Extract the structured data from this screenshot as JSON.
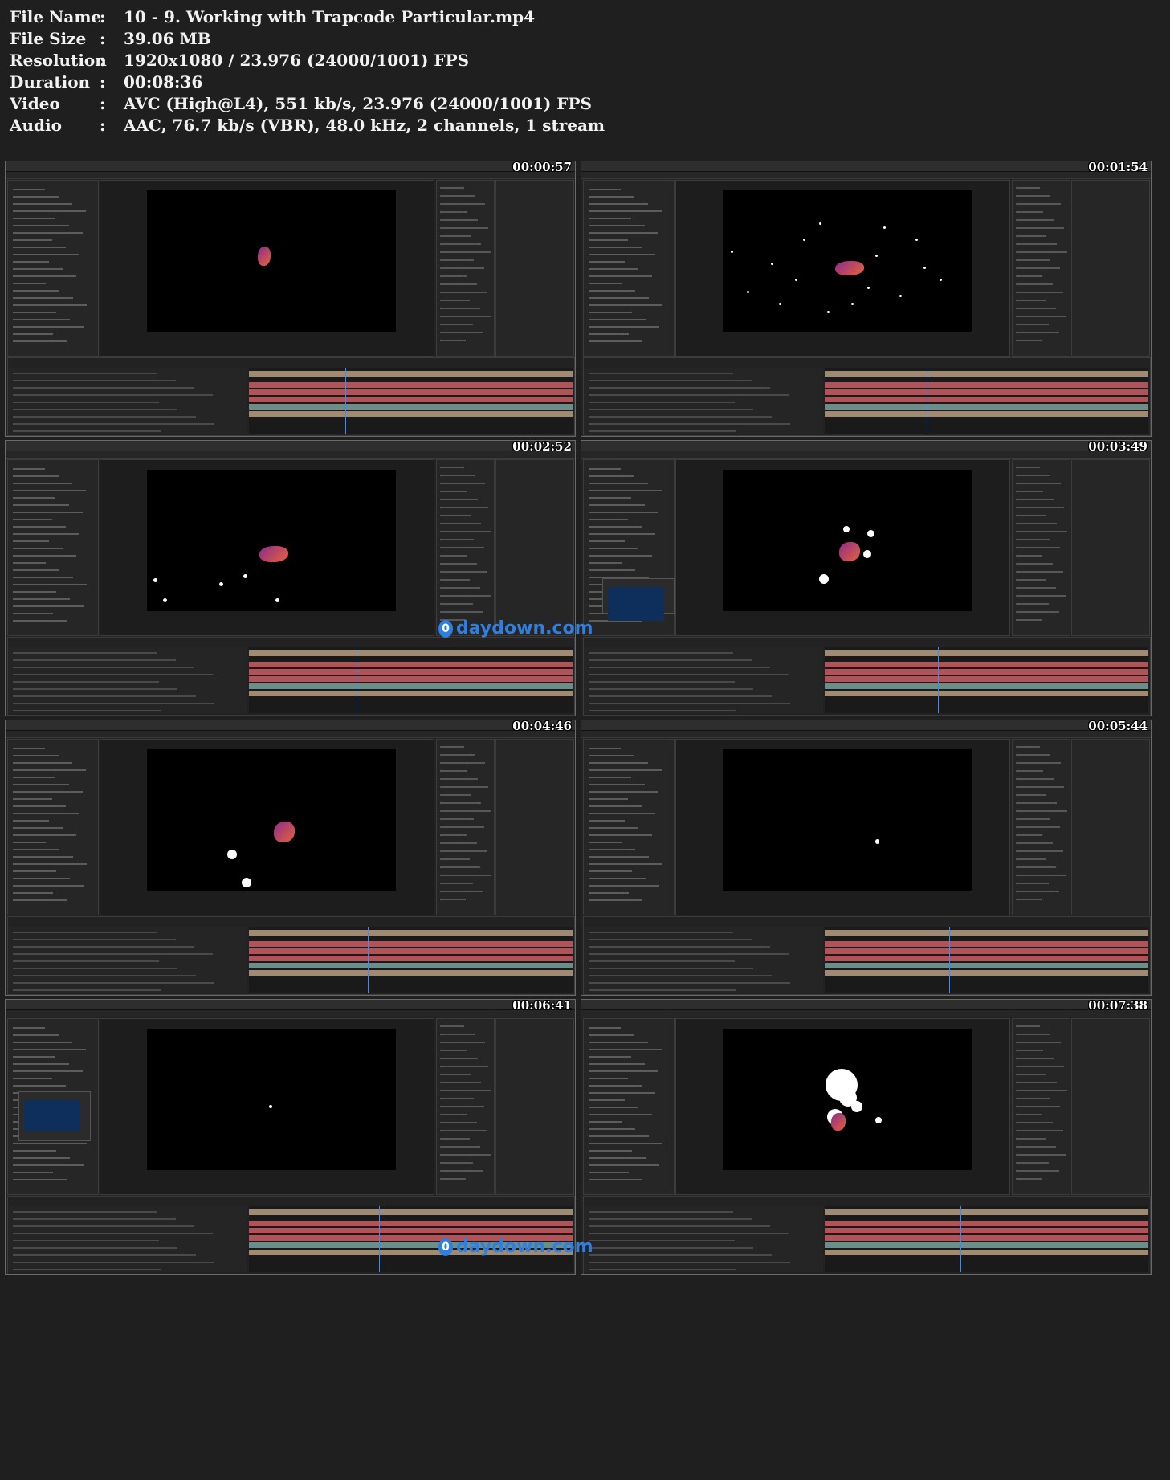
{
  "info": {
    "rows": [
      {
        "label": "File Name",
        "value": "10 - 9. Working with Trapcode Particular.mp4"
      },
      {
        "label": "File Size",
        "value": "39.06 MB"
      },
      {
        "label": "Resolution",
        "value": "1920x1080 / 23.976 (24000/1001) FPS"
      },
      {
        "label": "Duration",
        "value": "00:08:36"
      },
      {
        "label": "Video",
        "value": "AVC (High@L4), 551 kb/s, 23.976 (24000/1001) FPS"
      },
      {
        "label": "Audio",
        "value": "AAC, 76.7 kb/s (VBR), 48.0 kHz, 2 channels, 1 stream"
      }
    ],
    "separator": ":"
  },
  "thumbnails": [
    {
      "timestamp": "00:00:57"
    },
    {
      "timestamp": "00:01:54"
    },
    {
      "timestamp": "00:02:52"
    },
    {
      "timestamp": "00:03:49"
    },
    {
      "timestamp": "00:04:46"
    },
    {
      "timestamp": "00:05:44"
    },
    {
      "timestamp": "00:06:41"
    },
    {
      "timestamp": "00:07:38"
    }
  ],
  "watermark": {
    "text": "daydown.com",
    "icon": "daydown-logo-icon"
  },
  "colors": {
    "background": "#1f1f1f",
    "viewer": "#000000",
    "playhead": "#3b8cff",
    "bar_tan": "#a08a72",
    "bar_red": "#b0545a",
    "bar_teal": "#6b8e8a",
    "watermark": "#2f7fe0"
  }
}
